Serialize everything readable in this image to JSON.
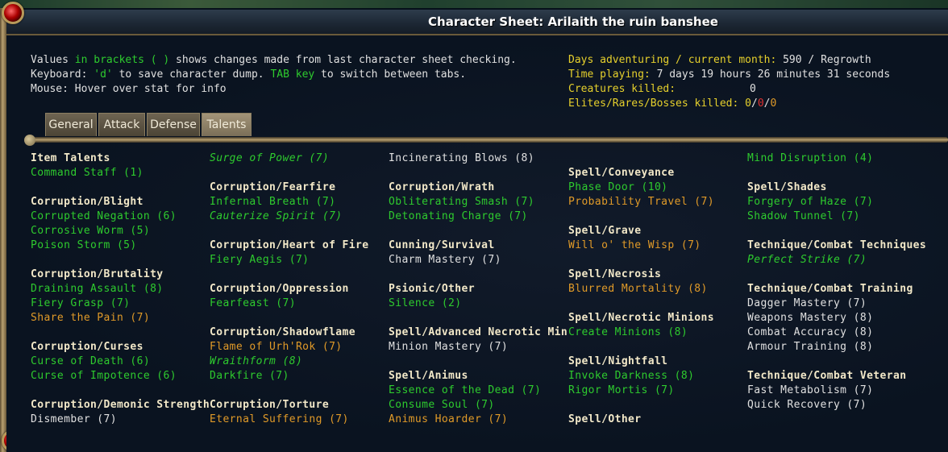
{
  "window": {
    "title": "Character Sheet: Arilaith the ruin banshee"
  },
  "info": {
    "line1": {
      "a": "Values ",
      "b": "in brackets ( )",
      "c": " shows changes made from last character sheet checking."
    },
    "line2": {
      "a": "Keyboard: ",
      "b": "'d'",
      "c": " to save character dump. ",
      "d": "TAB key",
      "e": " to switch between tabs."
    },
    "line3": "Mouse: Hover over stat for info"
  },
  "stats": {
    "days_label": "Days adventuring / current month:",
    "days_value": " 590 / Regrowth",
    "time_label": "Time playing:",
    "time_value": " 7 days 19 hours 26 minutes 31 seconds",
    "creatures_label": "Creatures killed:",
    "creatures_value": "0",
    "elites_label": "Elites/Rares/Bosses killed:",
    "elites_a": " 0",
    "sep": "/",
    "elites_b": "0",
    "elites_c": "0"
  },
  "tabs": [
    "General",
    "Attack",
    "Defense",
    "Talents"
  ],
  "colors": {
    "green": "#2ecb2e",
    "yellow": "#e6d02c",
    "orange": "#e09a28",
    "white": "#e0e0e0",
    "header": "#f2e8c8"
  },
  "talents": {
    "col1": [
      {
        "t": "Item Talents",
        "s": "hdr"
      },
      {
        "t": "Command Staff (1)",
        "s": "g"
      },
      {
        "t": "",
        "s": "blank"
      },
      {
        "t": "Corruption/Blight",
        "s": "hdr"
      },
      {
        "t": "Corrupted Negation (6)",
        "s": "g"
      },
      {
        "t": "Corrosive Worm (5)",
        "s": "g"
      },
      {
        "t": "Poison Storm (5)",
        "s": "g"
      },
      {
        "t": "",
        "s": "blank"
      },
      {
        "t": "Corruption/Brutality",
        "s": "hdr"
      },
      {
        "t": "Draining Assault (8)",
        "s": "g"
      },
      {
        "t": "Fiery Grasp (7)",
        "s": "g"
      },
      {
        "t": "Share the Pain (7)",
        "s": "o"
      },
      {
        "t": "",
        "s": "blank"
      },
      {
        "t": "Corruption/Curses",
        "s": "hdr"
      },
      {
        "t": "Curse of Death (6)",
        "s": "g"
      },
      {
        "t": "Curse of Impotence (6)",
        "s": "g"
      },
      {
        "t": "",
        "s": "blank"
      },
      {
        "t": "Corruption/Demonic Strength",
        "s": "hdr"
      },
      {
        "t": "Dismember (7)",
        "s": "w"
      }
    ],
    "col2": [
      {
        "t": "Surge of Power (7)",
        "s": "g i"
      },
      {
        "t": "",
        "s": "blank"
      },
      {
        "t": "Corruption/Fearfire",
        "s": "hdr"
      },
      {
        "t": "Infernal Breath (7)",
        "s": "g"
      },
      {
        "t": "Cauterize Spirit (7)",
        "s": "g i"
      },
      {
        "t": "",
        "s": "blank"
      },
      {
        "t": "Corruption/Heart of Fire",
        "s": "hdr"
      },
      {
        "t": "Fiery Aegis (7)",
        "s": "g"
      },
      {
        "t": "",
        "s": "blank"
      },
      {
        "t": "Corruption/Oppression",
        "s": "hdr"
      },
      {
        "t": "Fearfeast (7)",
        "s": "g"
      },
      {
        "t": "",
        "s": "blank"
      },
      {
        "t": "Corruption/Shadowflame",
        "s": "hdr"
      },
      {
        "t": "Flame of Urh'Rok (7)",
        "s": "o"
      },
      {
        "t": "Wraithform (8)",
        "s": "g i"
      },
      {
        "t": "Darkfire (7)",
        "s": "g"
      },
      {
        "t": "",
        "s": "blank"
      },
      {
        "t": "Corruption/Torture",
        "s": "hdr"
      },
      {
        "t": "Eternal Suffering (7)",
        "s": "o"
      }
    ],
    "col3": [
      {
        "t": "Incinerating Blows (8)",
        "s": "w"
      },
      {
        "t": "",
        "s": "blank"
      },
      {
        "t": "Corruption/Wrath",
        "s": "hdr"
      },
      {
        "t": "Obliterating Smash (7)",
        "s": "g"
      },
      {
        "t": "Detonating Charge (7)",
        "s": "g"
      },
      {
        "t": "",
        "s": "blank"
      },
      {
        "t": "Cunning/Survival",
        "s": "hdr"
      },
      {
        "t": "Charm Mastery (7)",
        "s": "w"
      },
      {
        "t": "",
        "s": "blank"
      },
      {
        "t": "Psionic/Other",
        "s": "hdr"
      },
      {
        "t": "Silence (2)",
        "s": "g"
      },
      {
        "t": "",
        "s": "blank"
      },
      {
        "t": "Spell/Advanced Necrotic Minions",
        "s": "hdr"
      },
      {
        "t": "Minion Mastery (7)",
        "s": "w"
      },
      {
        "t": "",
        "s": "blank"
      },
      {
        "t": "Spell/Animus",
        "s": "hdr"
      },
      {
        "t": "Essence of the Dead (7)",
        "s": "g"
      },
      {
        "t": "Consume Soul (7)",
        "s": "g"
      },
      {
        "t": "Animus Hoarder (7)",
        "s": "o"
      }
    ],
    "col4": [
      {
        "t": "",
        "s": "blank"
      },
      {
        "t": "Spell/Conveyance",
        "s": "hdr"
      },
      {
        "t": "Phase Door (10)",
        "s": "g"
      },
      {
        "t": "Probability Travel (7)",
        "s": "o"
      },
      {
        "t": "",
        "s": "blank"
      },
      {
        "t": "Spell/Grave",
        "s": "hdr"
      },
      {
        "t": "Will o' the Wisp (7)",
        "s": "o"
      },
      {
        "t": "",
        "s": "blank"
      },
      {
        "t": "Spell/Necrosis",
        "s": "hdr"
      },
      {
        "t": "Blurred Mortality (8)",
        "s": "o"
      },
      {
        "t": "",
        "s": "blank"
      },
      {
        "t": "Spell/Necrotic Minions",
        "s": "hdr"
      },
      {
        "t": "Create Minions (8)",
        "s": "g"
      },
      {
        "t": "",
        "s": "blank"
      },
      {
        "t": "Spell/Nightfall",
        "s": "hdr"
      },
      {
        "t": "Invoke Darkness (8)",
        "s": "g"
      },
      {
        "t": "Rigor Mortis (7)",
        "s": "g"
      },
      {
        "t": "",
        "s": "blank"
      },
      {
        "t": "Spell/Other",
        "s": "hdr"
      }
    ],
    "col5": [
      {
        "t": "Mind Disruption (4)",
        "s": "g"
      },
      {
        "t": "",
        "s": "blank"
      },
      {
        "t": "Spell/Shades",
        "s": "hdr"
      },
      {
        "t": "Forgery of Haze (7)",
        "s": "g"
      },
      {
        "t": "Shadow Tunnel (7)",
        "s": "g"
      },
      {
        "t": "",
        "s": "blank"
      },
      {
        "t": "Technique/Combat Techniques",
        "s": "hdr"
      },
      {
        "t": "Perfect Strike (7)",
        "s": "g i"
      },
      {
        "t": "",
        "s": "blank"
      },
      {
        "t": "Technique/Combat Training",
        "s": "hdr"
      },
      {
        "t": "Dagger Mastery (7)",
        "s": "w"
      },
      {
        "t": "Weapons Mastery (8)",
        "s": "w"
      },
      {
        "t": "Combat Accuracy (8)",
        "s": "w"
      },
      {
        "t": "Armour Training (8)",
        "s": "w"
      },
      {
        "t": "",
        "s": "blank"
      },
      {
        "t": "Technique/Combat Veteran",
        "s": "hdr"
      },
      {
        "t": "Fast Metabolism (7)",
        "s": "w"
      },
      {
        "t": "Quick Recovery (7)",
        "s": "w"
      }
    ]
  }
}
